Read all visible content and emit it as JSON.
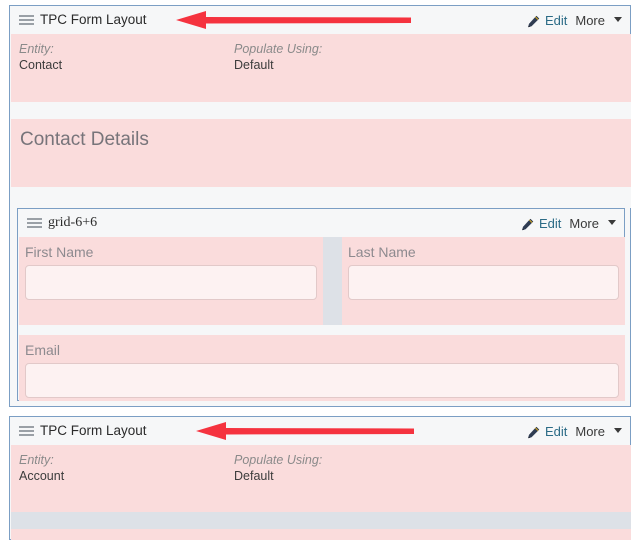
{
  "window": {
    "background": "#ffffff",
    "panel_border_color": "#7b9ec4",
    "pink_fill": "#fadcdc",
    "pink_soft_fill": "#fce4e4",
    "accent_link_color": "#2b6b86",
    "annotation_color": "#f5333f"
  },
  "common": {
    "menu_icon": "hamburger-menu-icon",
    "edit_icon": "pencil-icon",
    "edit_label": "Edit",
    "more_label": "More",
    "more_caret": "chevron-down-icon"
  },
  "panels": [
    {
      "id": "tpc-form-layout-contact",
      "title": "TPC Form Layout",
      "title_font": "sans",
      "entity_label": "Entity:",
      "entity_value": "Contact",
      "populate_label": "Populate Using:",
      "populate_value": "Default",
      "has_annotation_arrow": true
    },
    {
      "id": "grid-6-6",
      "title": "grid-6+6",
      "title_font": "serif",
      "has_annotation_arrow": false
    },
    {
      "id": "tpc-form-layout-account",
      "title": "TPC Form Layout",
      "title_font": "sans",
      "entity_label": "Entity:",
      "entity_value": "Account",
      "populate_label": "Populate Using:",
      "populate_value": "Default",
      "has_annotation_arrow": true
    }
  ],
  "section_heading": "Contact Details",
  "fields": {
    "first_name": {
      "label": "First Name",
      "value": "",
      "placeholder": ""
    },
    "last_name": {
      "label": "Last Name",
      "value": "",
      "placeholder": ""
    },
    "email": {
      "label": "Email",
      "value": "",
      "placeholder": ""
    }
  }
}
